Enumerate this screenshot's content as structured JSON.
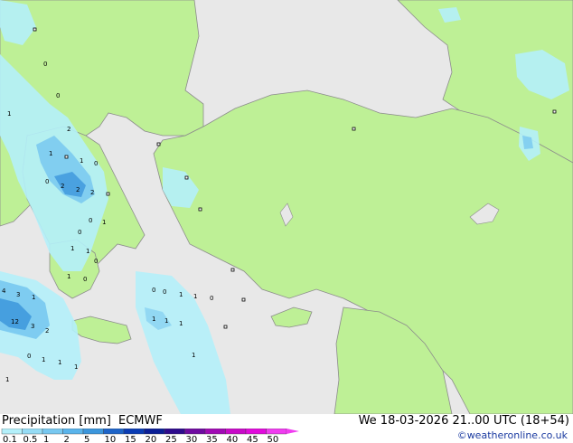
{
  "title": {
    "product": "Precipitation [mm]",
    "model": "ECMWF",
    "valid_time": "We 18-03-2026 21..00 UTC (18+54)"
  },
  "credit": "©weatheronline.co.uk",
  "legend": {
    "ticks": [
      "0.1",
      "0.5",
      "1",
      "2",
      "5",
      "10",
      "15",
      "20",
      "25",
      "30",
      "35",
      "40",
      "45",
      "50"
    ],
    "colors": [
      "#b4f0fa",
      "#96dcf5",
      "#78c8f0",
      "#5ab4eb",
      "#3c96dc",
      "#1e64c8",
      "#0a3cb4",
      "#0a1e96",
      "#2d0a8c",
      "#6e0aa0",
      "#a00ab4",
      "#c80ac8",
      "#e10adc",
      "#f03cf0"
    ]
  },
  "colors": {
    "land": "#bef096",
    "sea": "#e8e8e8",
    "coast": "#8c8c8c",
    "precip_light": "#b4f0fa",
    "precip_medium": "#78c8f0",
    "precip_heavy": "#3c96dc"
  },
  "map_labels": [
    "0",
    "0",
    "1",
    "2",
    "1",
    "1",
    "0",
    "2",
    "2",
    "2",
    "0",
    "0",
    "1",
    "0",
    "1",
    "1",
    "0",
    "1",
    "0",
    "4",
    "3",
    "1",
    "12",
    "3",
    "2",
    "0",
    "1",
    "1",
    "1",
    "0",
    "0",
    "1",
    "1",
    "0",
    "1",
    "1",
    "1",
    "1",
    "1"
  ]
}
